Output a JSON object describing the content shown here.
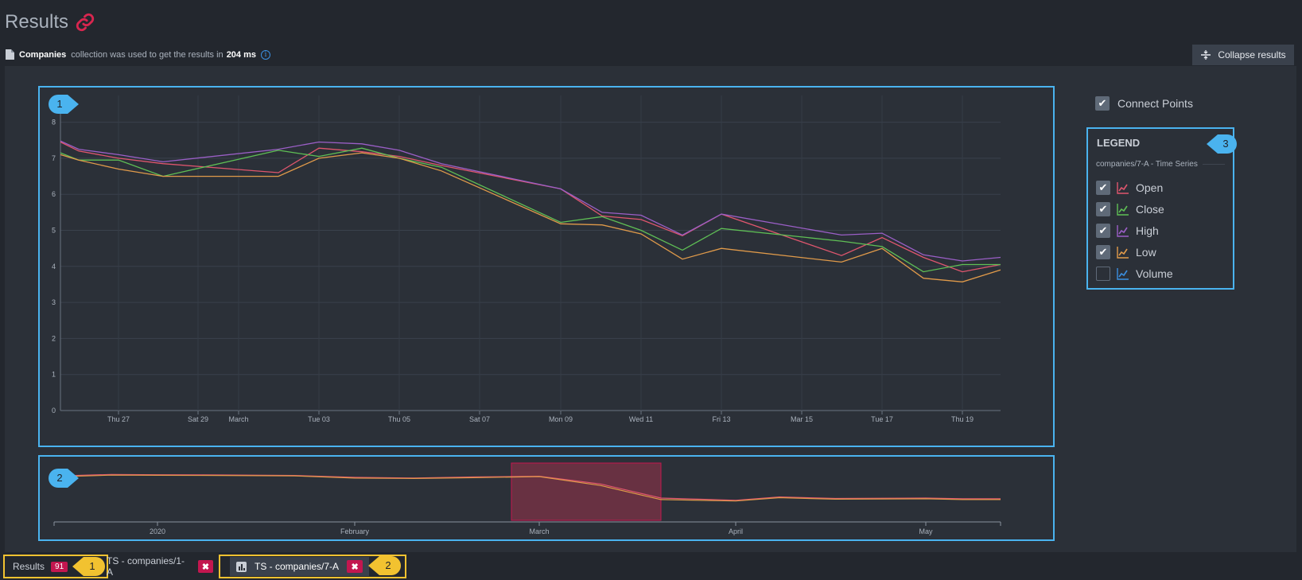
{
  "header": {
    "title": "Results",
    "link_icon": "link-icon"
  },
  "info": {
    "collection": "Companies",
    "text_mid": "collection  was used to get the results in",
    "time": "204 ms"
  },
  "toolbar": {
    "collapse_label": "Collapse results"
  },
  "controls": {
    "connect_points_label": "Connect Points",
    "connect_points_checked": true
  },
  "legend": {
    "title": "LEGEND",
    "series_group": "companies/7-A - Time Series",
    "items": [
      {
        "label": "Open",
        "checked": true,
        "color": "#e0566e"
      },
      {
        "label": "Close",
        "checked": true,
        "color": "#5fbf55"
      },
      {
        "label": "High",
        "checked": true,
        "color": "#9b5fc7"
      },
      {
        "label": "Low",
        "checked": true,
        "color": "#e09a4a"
      },
      {
        "label": "Volume",
        "checked": false,
        "color": "#3b8fe0"
      }
    ]
  },
  "annotations": {
    "main_chart": "1",
    "mini_chart": "2",
    "legend": "3",
    "tab_results": "1",
    "tab_7a": "2"
  },
  "tabs": {
    "results_label": "Results",
    "results_count": "91",
    "tab1_label": "TS - companies/1-A",
    "tab2_label": "TS - companies/7-A"
  },
  "chart_data": [
    {
      "type": "line",
      "title": "",
      "ylim": [
        0,
        8
      ],
      "y_ticks": [
        "0",
        "1",
        "2",
        "3",
        "4",
        "5",
        "6",
        "7",
        "8"
      ],
      "x_tick_labels": [
        "Thu 27",
        "Sat 29",
        "March",
        "Tue 03",
        "Thu 05",
        "Sat 07",
        "Mon 09",
        "Wed 11",
        "Fri 13",
        "Mar 15",
        "Tue 17",
        "Thu 19"
      ],
      "x": [
        "Feb 25",
        "Feb 26",
        "Feb 27",
        "Feb 28",
        "Mar 02",
        "Mar 03",
        "Mar 04",
        "Mar 05",
        "Mar 06",
        "Mar 09",
        "Mar 10",
        "Mar 11",
        "Mar 12",
        "Mar 13",
        "Mar 16",
        "Mar 17",
        "Mar 18",
        "Mar 19",
        "Mar 20"
      ],
      "series": [
        {
          "name": "Open",
          "values": [
            7.45,
            7.2,
            7.0,
            6.85,
            6.6,
            7.28,
            7.18,
            7.05,
            6.8,
            6.15,
            5.4,
            5.3,
            4.85,
            5.45,
            4.3,
            4.8,
            4.25,
            3.85,
            4.05
          ]
        },
        {
          "name": "Close",
          "values": [
            7.15,
            6.95,
            6.95,
            6.5,
            7.22,
            7.05,
            7.28,
            7.0,
            6.75,
            5.22,
            5.38,
            5.0,
            4.45,
            5.05,
            4.7,
            4.55,
            3.85,
            4.05,
            4.05
          ]
        },
        {
          "name": "High",
          "values": [
            7.48,
            7.25,
            7.1,
            6.9,
            7.25,
            7.45,
            7.4,
            7.22,
            6.85,
            6.15,
            5.5,
            5.42,
            4.87,
            5.45,
            4.87,
            4.92,
            4.32,
            4.15,
            4.25
          ]
        },
        {
          "name": "Low",
          "values": [
            7.1,
            6.95,
            6.7,
            6.5,
            6.5,
            7.0,
            7.15,
            7.0,
            6.65,
            5.18,
            5.15,
            4.9,
            4.2,
            4.5,
            4.12,
            4.5,
            3.67,
            3.57,
            3.9
          ]
        }
      ]
    },
    {
      "type": "line",
      "x_tick_labels": [
        "2020",
        "February",
        "March",
        "April",
        "May"
      ],
      "x": [
        "Dec 10",
        "Dec 20",
        "Jan 01",
        "Jan 10",
        "Jan 20",
        "Feb 01",
        "Feb 10",
        "Feb 20",
        "Mar 01",
        "Mar 10",
        "Mar 20",
        "Apr 01",
        "Apr 10",
        "Apr 20",
        "May 01",
        "May 10",
        "May 20"
      ],
      "series": [
        {
          "name": "Open",
          "values": [
            7.3,
            7.5,
            7.45,
            7.42,
            7.35,
            7.1,
            7.0,
            7.15,
            7.25,
            6.2,
            4.3,
            4.0,
            4.45,
            4.25,
            4.3,
            4.2,
            4.2
          ]
        },
        {
          "name": "Low",
          "values": [
            7.2,
            7.4,
            7.38,
            7.35,
            7.3,
            7.0,
            6.95,
            7.05,
            7.2,
            6.0,
            4.1,
            3.9,
            4.35,
            4.15,
            4.2,
            4.1,
            4.1
          ]
        }
      ],
      "selection": [
        "Mar 01",
        "Mar 20"
      ]
    }
  ]
}
